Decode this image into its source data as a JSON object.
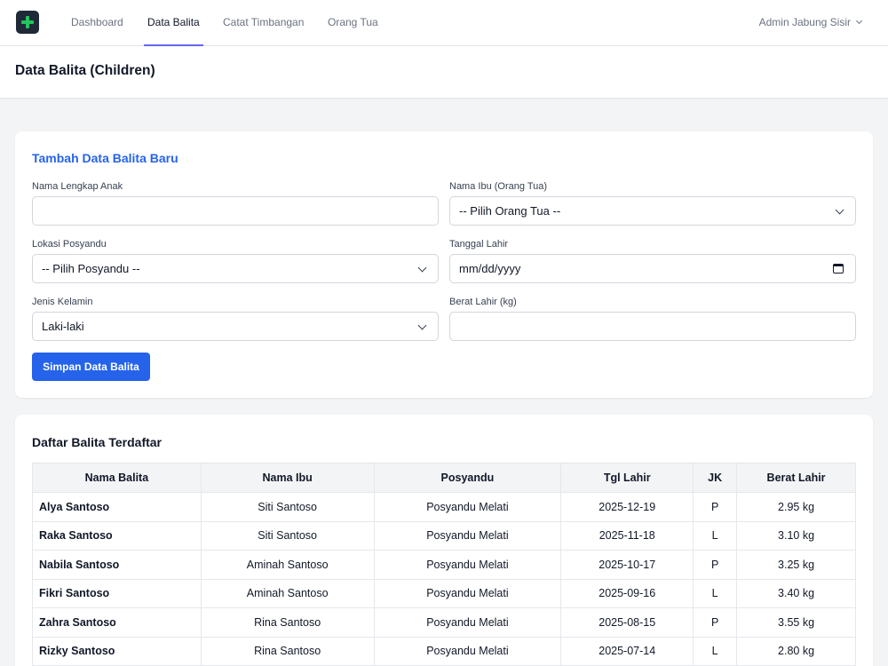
{
  "nav": {
    "links": [
      "Dashboard",
      "Data Balita",
      "Catat Timbangan",
      "Orang Tua"
    ],
    "active": "Data Balita",
    "user": "Admin Jabung Sisir"
  },
  "header": {
    "title": "Data Balita (Children)"
  },
  "form": {
    "title": "Tambah Data Balita Baru",
    "name_label": "Nama Lengkap Anak",
    "name_value": "",
    "mother_label": "Nama Ibu (Orang Tua)",
    "mother_value": "-- Pilih Orang Tua --",
    "posyandu_label": "Lokasi Posyandu",
    "posyandu_value": "-- Pilih Posyandu --",
    "dob_label": "Tanggal Lahir",
    "dob_value": "mm/dd/yyyy",
    "gender_label": "Jenis Kelamin",
    "gender_value": "Laki-laki",
    "weight_label": "Berat Lahir (kg)",
    "weight_value": "",
    "save_label": "Simpan Data Balita"
  },
  "table": {
    "title": "Daftar Balita Terdaftar",
    "headers": [
      "Nama Balita",
      "Nama Ibu",
      "Posyandu",
      "Tgl Lahir",
      "JK",
      "Berat Lahir"
    ],
    "rows": [
      [
        "Alya Santoso",
        "Siti Santoso",
        "Posyandu Melati",
        "2025-12-19",
        "P",
        "2.95 kg"
      ],
      [
        "Raka Santoso",
        "Siti Santoso",
        "Posyandu Melati",
        "2025-11-18",
        "L",
        "3.10 kg"
      ],
      [
        "Nabila Santoso",
        "Aminah Santoso",
        "Posyandu Melati",
        "2025-10-17",
        "P",
        "3.25 kg"
      ],
      [
        "Fikri Santoso",
        "Aminah Santoso",
        "Posyandu Melati",
        "2025-09-16",
        "L",
        "3.40 kg"
      ],
      [
        "Zahra Santoso",
        "Rina Santoso",
        "Posyandu Melati",
        "2025-08-15",
        "P",
        "3.55 kg"
      ],
      [
        "Rizky Santoso",
        "Rina Santoso",
        "Posyandu Melati",
        "2025-07-14",
        "L",
        "2.80 kg"
      ]
    ]
  },
  "colors": {
    "accent": "#2563eb",
    "nav_underline": "#6366f1",
    "logo_bg": "#1f2937",
    "logo_cross": "#22c55e"
  }
}
